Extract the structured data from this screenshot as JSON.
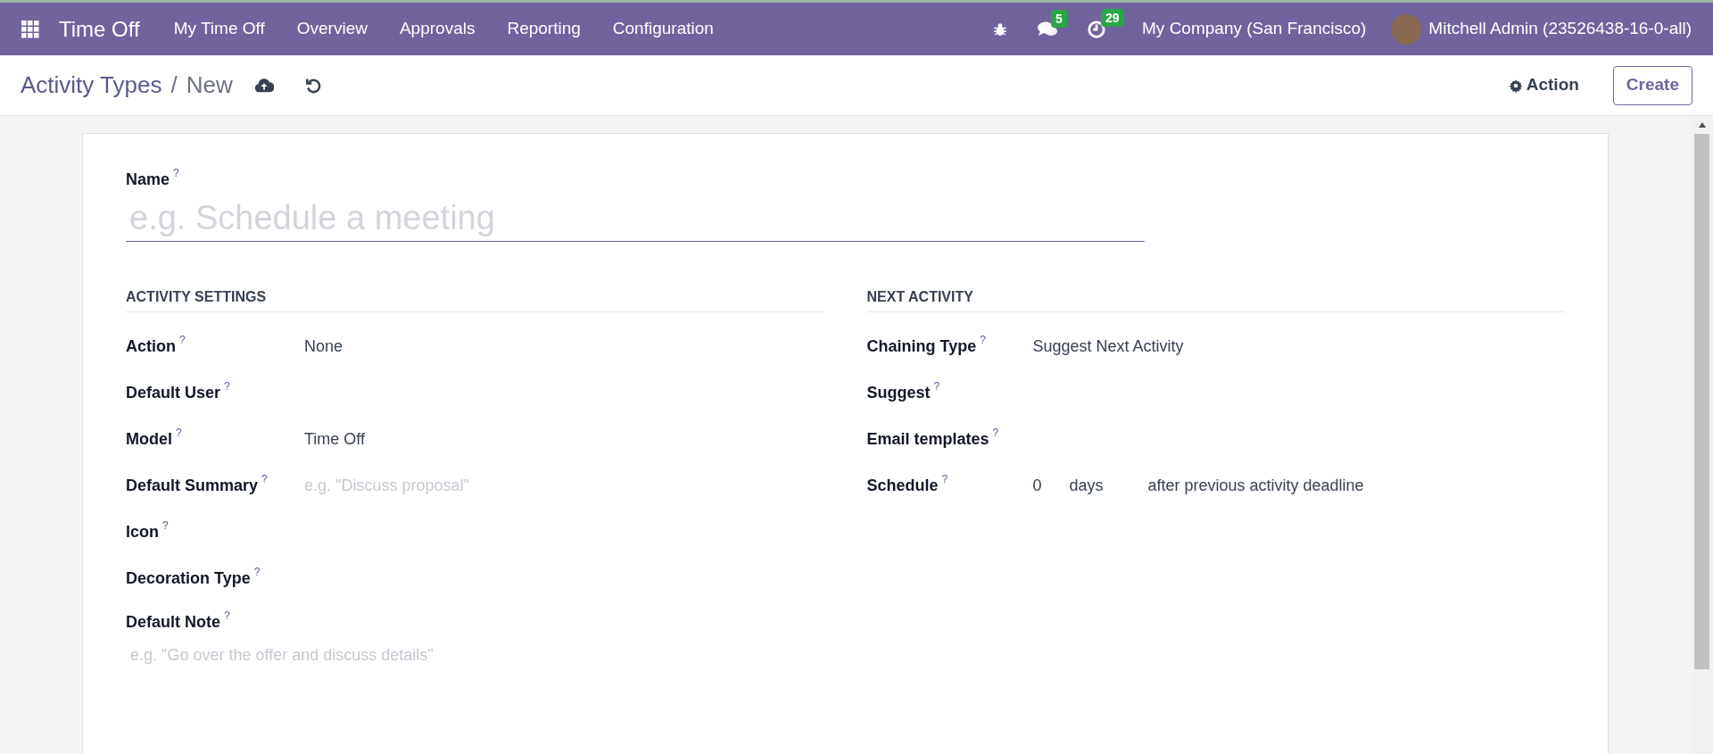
{
  "navbar": {
    "app_name": "Time Off",
    "menu": [
      {
        "label": "My Time Off"
      },
      {
        "label": "Overview"
      },
      {
        "label": "Approvals"
      },
      {
        "label": "Reporting"
      },
      {
        "label": "Configuration"
      }
    ],
    "systray": [
      {
        "kind": "bug"
      },
      {
        "kind": "chat",
        "count": "5"
      },
      {
        "kind": "clock",
        "count": "29"
      }
    ],
    "company": "My Company (San Francisco)",
    "user": "Mitchell Admin (23526438-16-0-all)"
  },
  "control_panel": {
    "breadcrumb": [
      {
        "label": "Activity Types"
      },
      {
        "label": "/"
      },
      {
        "label": "New"
      }
    ],
    "action": "Action",
    "create": "Create"
  },
  "form": {
    "name": {
      "label": "Name",
      "help": "?",
      "placeholder": "e.g. Schedule a meeting"
    },
    "groups": [
      {
        "title": "ACTIVITY SETTINGS",
        "fields": [
          {
            "label": "Action",
            "help": "?",
            "kind": "value",
            "value": "None"
          },
          {
            "label": "Default User",
            "help": "?",
            "kind": "empty"
          },
          {
            "label": "Model",
            "help": "?",
            "kind": "value",
            "value": "Time Off"
          },
          {
            "label": "Default Summary",
            "help": "?",
            "kind": "placeholder",
            "placeholder": "e.g. \"Discuss proposal\""
          },
          {
            "label": "Icon",
            "help": "?",
            "kind": "empty"
          },
          {
            "label": "Decoration Type",
            "help": "?",
            "kind": "empty"
          }
        ]
      },
      {
        "title": "NEXT ACTIVITY",
        "fields": [
          {
            "label": "Chaining Type",
            "help": "?",
            "kind": "value",
            "value": "Suggest Next Activity"
          },
          {
            "label": "Suggest",
            "help": "?",
            "kind": "empty"
          },
          {
            "label": "Email templates",
            "help": "?",
            "kind": "empty"
          },
          {
            "label": "Schedule",
            "help": "?",
            "kind": "schedule",
            "parts": [
              "0",
              "days",
              "after previous activity deadline"
            ]
          }
        ]
      }
    ],
    "note": {
      "label": "Default Note",
      "help": "?",
      "placeholder": "e.g. \"Go over the offer and discuss details\""
    }
  }
}
